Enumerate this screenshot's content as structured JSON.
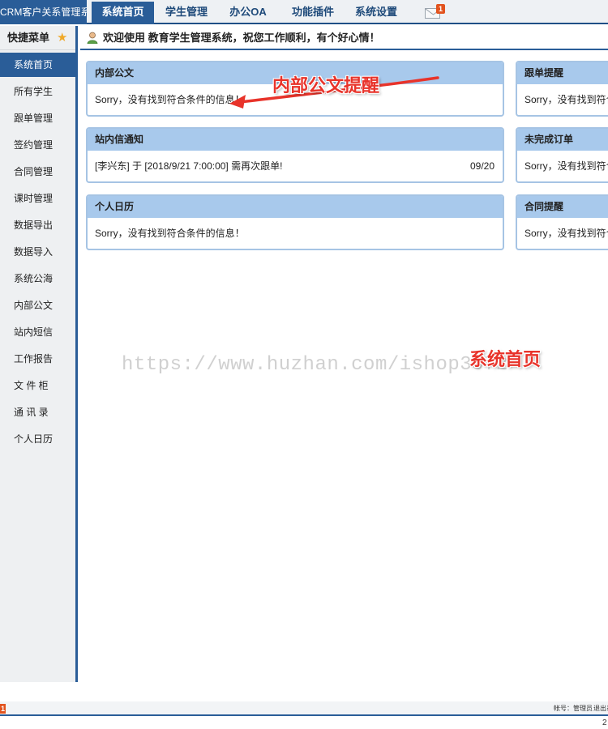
{
  "app": {
    "title": "CRM客户关系管理系统"
  },
  "top_tabs": [
    "系统首页",
    "学生管理",
    "办公OA",
    "功能插件",
    "系统设置"
  ],
  "mail": {
    "icon": "mail-icon",
    "badge": "1"
  },
  "sidebar": {
    "header": "快捷菜单",
    "header_icon": "star-icon",
    "items": [
      "系统首页",
      "所有学生",
      "跟单管理",
      "签约管理",
      "合同管理",
      "课时管理",
      "数据导出",
      "数据导入",
      "系统公海",
      "内部公文",
      "站内短信",
      "工作报告",
      "文 件 柜",
      "通 讯 录",
      "个人日历"
    ]
  },
  "welcome": {
    "icon": "user-icon",
    "text": "欢迎使用 教育学生管理系统，祝您工作顺利，有个好心情！"
  },
  "panels": {
    "docs": {
      "title": "内部公文",
      "body": "Sorry，没有找到符合条件的信息！"
    },
    "messages": {
      "title": "站内信通知",
      "body": "[李兴东] 于 [2018/9/21 7:00:00] 需再次跟单!",
      "date": "09/20"
    },
    "calendar": {
      "title": "个人日历",
      "body": "Sorry，没有找到符合条件的信息！"
    },
    "followup": {
      "title": "跟单提醒",
      "body": "Sorry，没有找到符合"
    },
    "orders": {
      "title": "未完成订单",
      "body": "Sorry，没有找到符合"
    },
    "contracts": {
      "title": "合同提醒",
      "body": "Sorry，没有找到符合"
    }
  },
  "annotations": {
    "arrow_label": "内部公文提醒",
    "page_label": "系统首页",
    "color": "#e8332a"
  },
  "watermark": "https://www.huzhan.com/ishop3572",
  "status": {
    "badge": "1",
    "account": "帐号：管理员",
    "logout": "退出系统"
  },
  "corner_glyph": "2",
  "colors": {
    "primary": "#2a5d98",
    "panel_header": "#a8c9ec",
    "panel_border": "#a6c4e4",
    "badge": "#e2531e"
  }
}
